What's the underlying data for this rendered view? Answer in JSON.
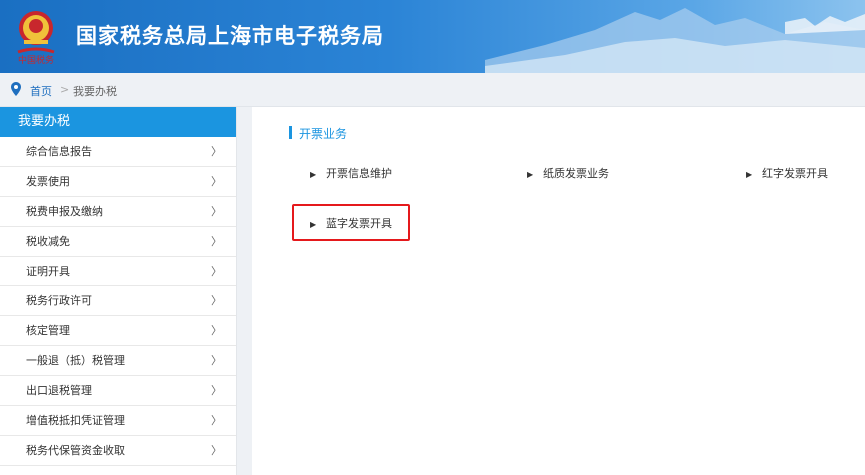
{
  "header": {
    "title": "国家税务总局上海市电子税务局",
    "emblem_caption": "中国税务"
  },
  "breadcrumb": {
    "home": "首页",
    "separator": ">",
    "current": "我要办税"
  },
  "sidebar": {
    "title": "我要办税",
    "items": [
      {
        "label": "综合信息报告"
      },
      {
        "label": "发票使用"
      },
      {
        "label": "税费申报及缴纳"
      },
      {
        "label": "税收减免"
      },
      {
        "label": "证明开具"
      },
      {
        "label": "税务行政许可"
      },
      {
        "label": "核定管理"
      },
      {
        "label": "一般退（抵）税管理"
      },
      {
        "label": "出口退税管理"
      },
      {
        "label": "增值税抵扣凭证管理"
      },
      {
        "label": "税务代保管资金收取"
      }
    ],
    "chevron": "〉"
  },
  "section": {
    "title": "开票业务",
    "links": [
      {
        "label": "开票信息维护"
      },
      {
        "label": "纸质发票业务"
      },
      {
        "label": "红字发票开具"
      },
      {
        "label": "蓝字发票开具"
      }
    ],
    "arrow": "▶"
  },
  "colors": {
    "accent": "#1b95e0",
    "highlight": "#e5191c",
    "header": "#2b84d6"
  }
}
